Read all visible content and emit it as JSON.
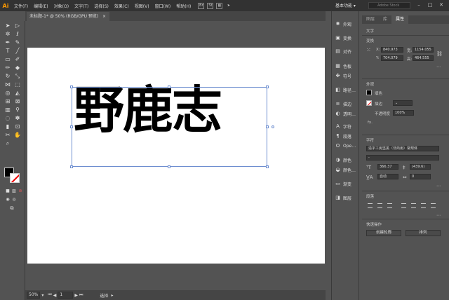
{
  "app": {
    "logo": "Ai"
  },
  "menu": [
    "文件(F)",
    "编辑(E)",
    "对象(O)",
    "文字(T)",
    "选择(S)",
    "效果(C)",
    "视图(V)",
    "窗口(W)",
    "帮助(H)"
  ],
  "menubar_icons": [
    "Br",
    "St"
  ],
  "workspace_label": "基本功能",
  "search": {
    "placeholder": "Adobe Stock"
  },
  "document_tab": {
    "title": "未标题-1* @ 50% (RGB/GPU 预览)",
    "close": "×"
  },
  "artwork_text": "野鹿志",
  "statusbar": {
    "zoom": "50%",
    "artboard_num": "1",
    "tool_name": "选择"
  },
  "dock": [
    {
      "icon": "sun-icon",
      "glyph": "✺",
      "label": "外观"
    },
    {
      "icon": "transform-icon",
      "glyph": "▣",
      "label": "变换"
    },
    {
      "icon": "align-icon",
      "glyph": "▤",
      "label": "对齐"
    },
    {
      "icon": "swatches-icon",
      "glyph": "▦",
      "label": "色板"
    },
    {
      "icon": "symbols-icon",
      "glyph": "✤",
      "label": "符号"
    },
    {
      "icon": "pathfinder-icon",
      "glyph": "◧",
      "label": "路径…"
    },
    {
      "icon": "stroke-icon",
      "glyph": "≡",
      "label": "描边"
    },
    {
      "icon": "transparency-icon",
      "glyph": "◐",
      "label": "透明…"
    },
    {
      "icon": "character-icon",
      "glyph": "A",
      "label": "字符"
    },
    {
      "icon": "paragraph-icon",
      "glyph": "¶",
      "label": "段落"
    },
    {
      "icon": "opentype-icon",
      "glyph": "O",
      "label": "Ope…"
    },
    {
      "icon": "color-icon",
      "glyph": "◑",
      "label": "颜色"
    },
    {
      "icon": "color-guide-icon",
      "glyph": "◒",
      "label": "颜色…"
    },
    {
      "icon": "gradient-icon",
      "glyph": "▭",
      "label": "渐变"
    },
    {
      "icon": "layers-icon",
      "glyph": "◨",
      "label": "图层"
    }
  ],
  "panel": {
    "tabs": [
      "图层",
      "库",
      "属性"
    ],
    "active_tab": "属性",
    "section_type": "文字",
    "transform_label": "变换",
    "x_label": "X:",
    "x_value": "840.973",
    "y_label": "Y:",
    "y_value": "704.079",
    "w_label": "宽:",
    "w_value": "1154.055",
    "h_label": "高:",
    "h_value": "464.555",
    "appearance_label": "外观",
    "fill_label": "填色",
    "stroke_label": "描边",
    "opacity_label": "不透明度",
    "opacity_value": "100%",
    "fx_label": "fx.",
    "character_label": "字符",
    "font_name": "造字工房坚黑（非商用）常规体",
    "font_style": "-",
    "font_size": "366.37",
    "leading_value": "(439.6)",
    "auto_label": "自动",
    "tracking_value": "0",
    "paragraph_label": "段落",
    "quick_actions_label": "快速操作",
    "create_outlines_button": "创建轮廓",
    "arrange_button": "排列"
  }
}
